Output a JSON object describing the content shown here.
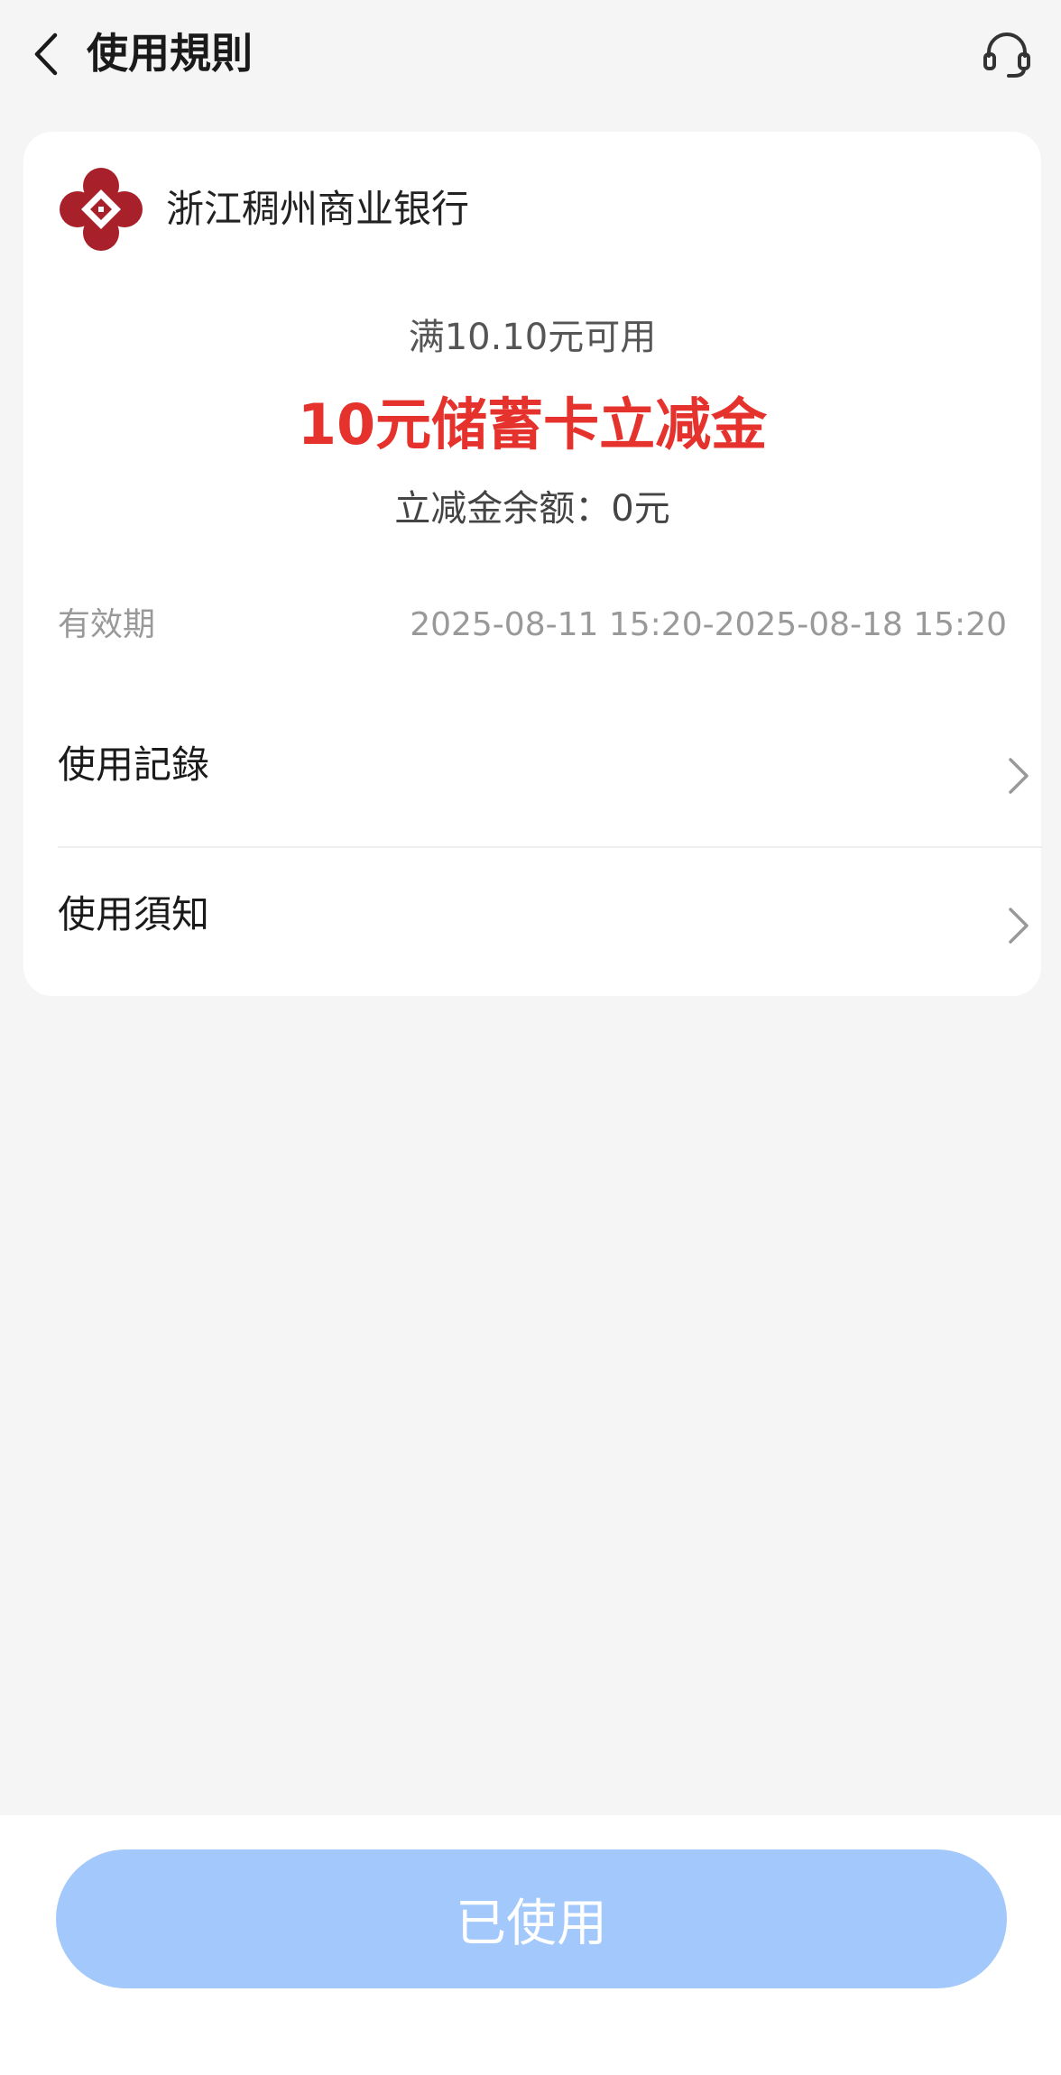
{
  "header": {
    "title": "使用規則",
    "back_icon": "chevron-left-icon",
    "support_icon": "headset-icon"
  },
  "card": {
    "bank_name": "浙江稠州商业银行",
    "bank_logo_color": "#a8202a",
    "threshold": "满10.10元可用",
    "coupon_title": "10元储蓄卡立减金",
    "coupon_title_color": "#e5322d",
    "balance": "立减金余额：0元",
    "validity_label": "有效期",
    "validity_value": "2025-08-11 15:20-2025-08-18 15:20",
    "menu": [
      {
        "label": "使用記錄",
        "icon": "chevron-right-icon"
      },
      {
        "label": "使用須知",
        "icon": "chevron-right-icon"
      }
    ]
  },
  "footer": {
    "status_button": "已使用",
    "status_button_color": "#a3c8fb"
  }
}
